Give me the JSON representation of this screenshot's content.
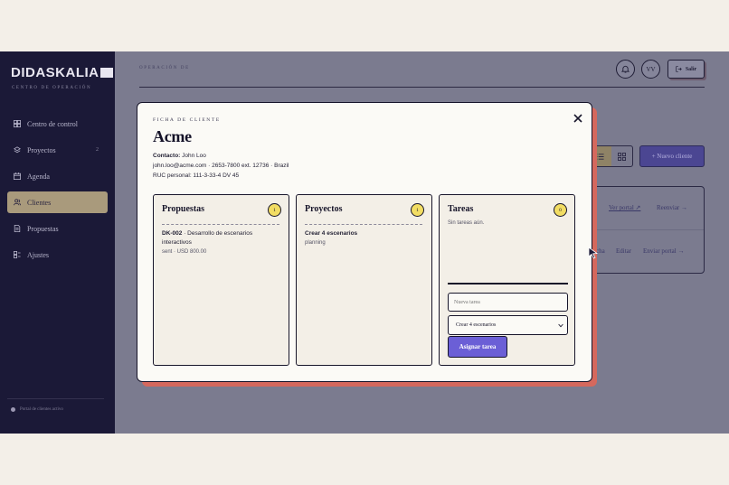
{
  "brand": {
    "name": "DIDASKALIA",
    "subtitle": "CENTRO DE OPERACIÓN"
  },
  "sidebar": {
    "items": [
      {
        "label": "Centro de control",
        "icon": "dashboard-icon"
      },
      {
        "label": "Proyectos",
        "icon": "layers-icon",
        "count": "2"
      },
      {
        "label": "Agenda",
        "icon": "calendar-icon"
      },
      {
        "label": "Clientes",
        "icon": "users-icon",
        "active": true
      },
      {
        "label": "Propuestas",
        "icon": "document-icon"
      },
      {
        "label": "Ajustes",
        "icon": "settings-icon"
      }
    ],
    "footer": "Portal de clientes activo"
  },
  "header": {
    "label": "OPERACIÓN DE",
    "avatar_initials": "VV",
    "exit_label": "Salir"
  },
  "background": {
    "new_client_label": "+ Nuevo cliente",
    "row1": {
      "partial": "ar",
      "view_portal": "Ver portal ↗",
      "resend": "Reenviar →"
    },
    "row2": {
      "partial": "cha",
      "edit": "Editar",
      "send_portal": "Enviar portal →"
    }
  },
  "modal": {
    "eyebrow": "FICHA DE CLIENTE",
    "title": "Acme",
    "contact_label": "Contacto:",
    "contact_name": "John Loo",
    "contact_line": "john.loo@acme.com · 2653-7800 ext. 12736 · Brazil",
    "ruc_line": "RUC personal: 111-3-33-4 DV 45",
    "proposals": {
      "title": "Propuestas",
      "count": "1",
      "items": [
        {
          "code": "DK-002",
          "title_line1": " · Desarrollo de escenarios",
          "title_line2": "interactivos",
          "meta": "sent · USD 800.00"
        }
      ]
    },
    "projects": {
      "title": "Proyectos",
      "count": "1",
      "items": [
        {
          "name": "Crear 4 escenarios",
          "status": "planning"
        }
      ]
    },
    "tasks": {
      "title": "Tareas",
      "count": "0",
      "empty": "Sin tareas aún.",
      "input_placeholder": "Nueva tarea",
      "select_value": "Crear 4 escenarios",
      "assign_label": "Asignar tarea"
    }
  },
  "colors": {
    "sidebar_bg": "#1b1937",
    "app_bg": "#7b7b8f",
    "accent": "#6b5fd6",
    "modal_shadow": "#d5685d",
    "badge": "#f2dd63"
  }
}
